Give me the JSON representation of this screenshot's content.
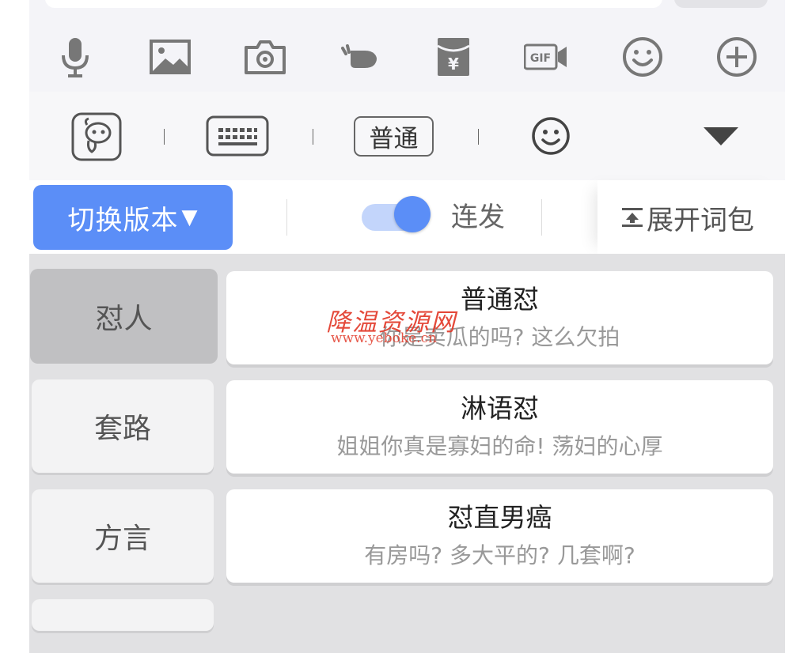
{
  "toolbar_icons": [
    "microphone-icon",
    "image-icon",
    "camera-icon",
    "pointing-hand-icon",
    "red-envelope-yen-icon",
    "gif-video-icon",
    "smiley-icon",
    "plus-circle-icon"
  ],
  "mode_bar": {
    "putong_label": "普通"
  },
  "action_bar": {
    "switch_version_label": "切换版本",
    "switch_caret": "▼",
    "lianfa_label": "连发",
    "lianfa_enabled": true,
    "expand_label": "展开词包"
  },
  "categories": [
    {
      "label": "怼人",
      "active": true
    },
    {
      "label": "套路",
      "active": false
    },
    {
      "label": "方言",
      "active": false
    }
  ],
  "cards": [
    {
      "title": "普通怼",
      "subtitle": "你是卖瓜的吗? 这么欠拍"
    },
    {
      "title": "淋语怼",
      "subtitle": "姐姐你真是寡妇的命! 荡妇的心厚"
    },
    {
      "title": "怼直男癌",
      "subtitle": "有房吗? 多大平的? 几套啊?"
    }
  ],
  "watermark": {
    "text": "降温资源网",
    "url": "www.yeboke.cn"
  },
  "colors": {
    "accent": "#5b8ef7",
    "toggle_track": "#c3d5fb",
    "content_bg": "#e1e1e3",
    "active_category": "#c0c0c2",
    "watermark": "#e23a2a"
  }
}
